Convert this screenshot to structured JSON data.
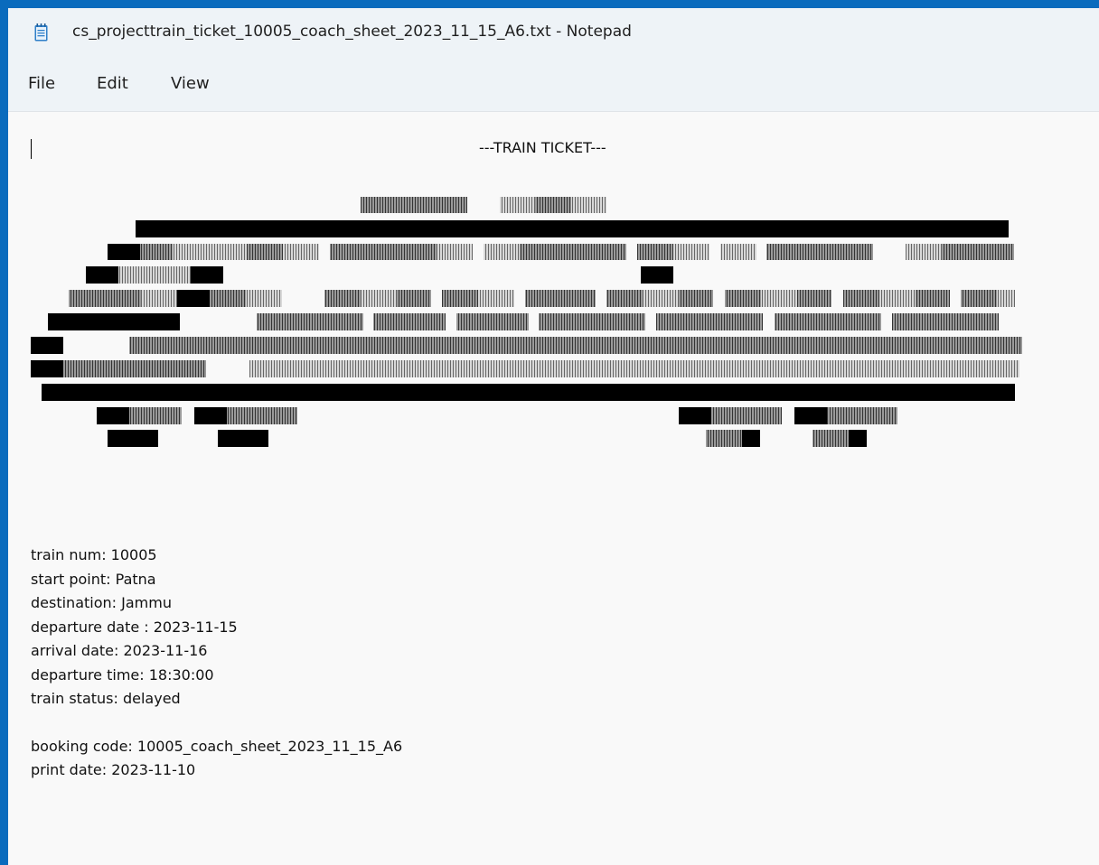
{
  "window": {
    "title": "cs_projecttrain_ticket_10005_coach_sheet_2023_11_15_A6.txt - Notepad",
    "icon": "notepad-icon",
    "accent_color": "#0a6bbd"
  },
  "menu": {
    "file": "File",
    "edit": "Edit",
    "view": "View"
  },
  "document": {
    "heading": "---TRAIN TICKET---",
    "details": [
      "train num: 10005",
      "start point: Patna",
      "destination: Jammu",
      "departure date : 2023-11-15",
      "arrival date: 2023-11-16",
      "departure time: 18:30:00",
      "train status: delayed"
    ],
    "booking": [
      "booking code: 10005_coach_sheet_2023_11_15_A6",
      "print date: 2023-11-10"
    ]
  }
}
